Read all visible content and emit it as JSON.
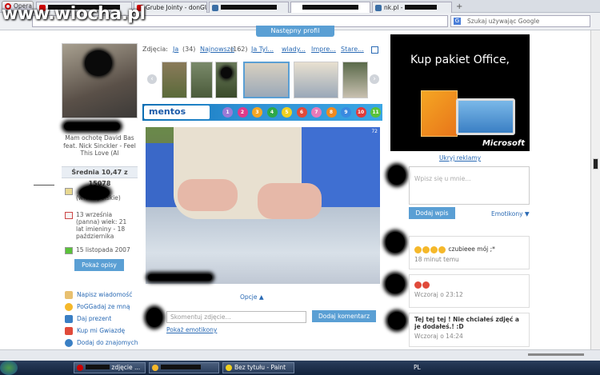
{
  "browser": {
    "menu_label": "Opera",
    "watermark": "www.wiocha.pl",
    "tabs": [
      {
        "label": "",
        "redacted": true
      },
      {
        "label": "Grube Jointy - donGUR..."
      },
      {
        "label": "",
        "redacted": true
      },
      {
        "label": "",
        "redacted": true
      },
      {
        "label": "nk.pl - ",
        "redacted": true
      }
    ],
    "search_placeholder": "Szukaj używając Google"
  },
  "profile": {
    "next_profile_label": "Następny profil",
    "status_text": "Mam ochotę David Bas feat. Nick Sinckler - Feel This Love (Al",
    "rating": "Średnia 10,47 z 15078",
    "info": {
      "region": "(wielkopolskie)",
      "birthday": "13 września (panna) wiek: 21 lat imieniny - 18 października",
      "joined": "15 listopada 2007"
    },
    "show_descriptions": "Pokaż opisy",
    "actions": [
      "Napisz wiadomość",
      "PoGGadaj ze mną",
      "Daj prezent",
      "Kup mi Gwiazdę",
      "Dodaj do znajomych"
    ]
  },
  "gallery": {
    "label": "Zdjęcia:",
    "tabs": [
      "Ja",
      "(34)",
      "Najnowsze",
      "(162)",
      "Ja Tyl...",
      "wlady...",
      "Impre...",
      "Stare..."
    ],
    "photo_number": "72",
    "options_label": "Opcje ▲",
    "comment_placeholder": "Skomentuj zdjęcie...",
    "comment_button": "Dodaj komentarz",
    "emoticons_link": "Pokaż emotikony"
  },
  "mentos": {
    "logo": "mentos",
    "balls": [
      "1",
      "2",
      "3",
      "4",
      "5",
      "6",
      "7",
      "8",
      "9",
      "10",
      "11"
    ],
    "colors": [
      "#9b7ad6",
      "#e03a8a",
      "#f5a623",
      "#2da84a",
      "#f0d020",
      "#e04a3a",
      "#e87ab8",
      "#f08a20",
      "#3a8ae0",
      "#e03a3a",
      "#5ac23a"
    ]
  },
  "ad": {
    "title": "Kup pakiet Office,",
    "brand": "Microsoft",
    "hide_link": "Ukryj reklamy"
  },
  "wall": {
    "placeholder": "Wpisz się u mnie...",
    "add_button": "Dodaj wpis",
    "emoticons_label": "Emotikony ▼",
    "posts": [
      {
        "text": "czubieee mój ;*",
        "time": "18 minut temu"
      },
      {
        "text": "",
        "time": "Wczoraj o 23:12"
      },
      {
        "text": "Tej tej tej ! Nie chciałeś zdjęć a je dodałeś.! :D",
        "time": "Wczoraj o 14:24"
      }
    ]
  },
  "taskbar": {
    "tasks": [
      "",
      "zdjęcie ...",
      "",
      "Bez tytułu - Paint"
    ],
    "lang": "PL"
  }
}
